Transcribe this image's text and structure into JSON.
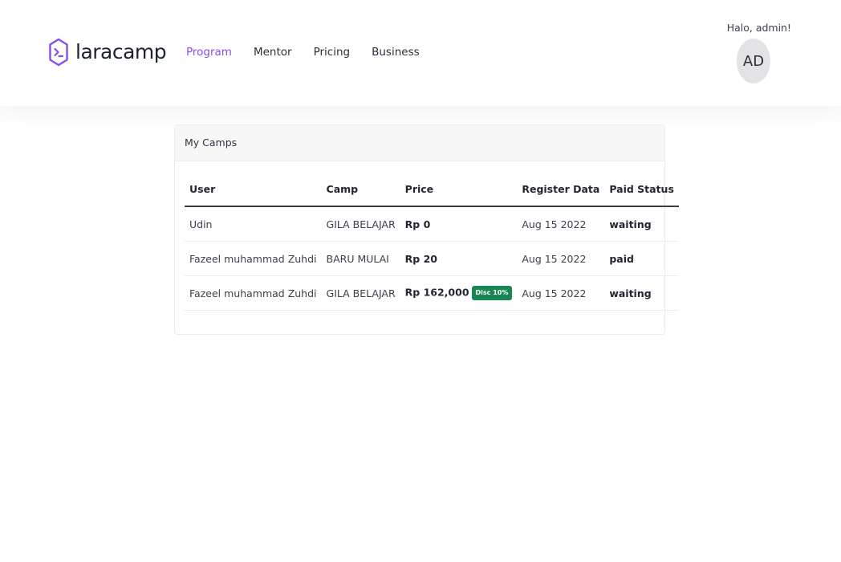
{
  "brand": {
    "name": "laracamp",
    "accent_color": "#8a4cf0"
  },
  "nav": {
    "items": [
      {
        "label": "Program",
        "active": true
      },
      {
        "label": "Mentor",
        "active": false
      },
      {
        "label": "Pricing",
        "active": false
      },
      {
        "label": "Business",
        "active": false
      }
    ]
  },
  "user": {
    "greeting": "Halo, admin!",
    "avatar_initials": "AD"
  },
  "card": {
    "title": "My Camps"
  },
  "table": {
    "headers": [
      "User",
      "Camp",
      "Price",
      "Register Data",
      "Paid Status"
    ],
    "rows": [
      {
        "user": "Udin",
        "camp": "GILA BELAJAR",
        "price": "Rp 0",
        "discount": "",
        "register_date": "Aug 15 2022",
        "paid_status": "waiting"
      },
      {
        "user": "Fazeel muhammad Zuhdi",
        "camp": "BARU MULAI",
        "price": "Rp 20",
        "discount": "",
        "register_date": "Aug 15 2022",
        "paid_status": "paid"
      },
      {
        "user": "Fazeel muhammad Zuhdi",
        "camp": "GILA BELAJAR",
        "price": "Rp 162,000",
        "discount": "Disc 10%",
        "register_date": "Aug 15 2022",
        "paid_status": "waiting"
      }
    ]
  },
  "colors": {
    "badge_success": "#198754"
  }
}
